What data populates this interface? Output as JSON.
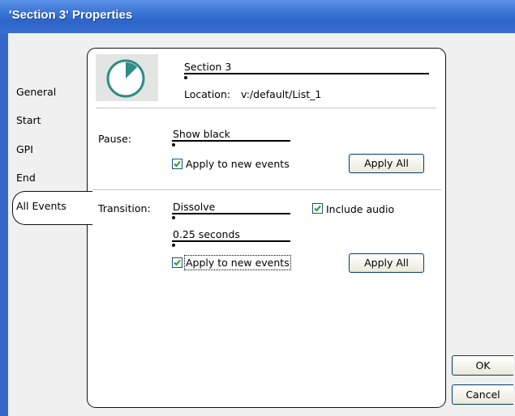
{
  "window": {
    "title": "'Section 3' Properties"
  },
  "tabs": [
    {
      "label": "General"
    },
    {
      "label": "Start"
    },
    {
      "label": "GPI"
    },
    {
      "label": "End"
    },
    {
      "label": "All Events",
      "selected": true
    }
  ],
  "header": {
    "section_name": "Section 3",
    "location_label": "Location:",
    "location_value": "v:/default/List_1",
    "icon": "clock-pie-icon"
  },
  "pause": {
    "label": "Pause:",
    "value": "Show black",
    "apply_new_label": "Apply to new events",
    "apply_new_checked": true,
    "apply_all_label": "Apply All"
  },
  "transition": {
    "label": "Transition:",
    "type_value": "Dissolve",
    "duration_value": "0.25 seconds",
    "include_audio_label": "Include audio",
    "include_audio_checked": true,
    "apply_new_label": "Apply to new events",
    "apply_new_checked": true,
    "apply_all_label": "Apply All"
  },
  "buttons": {
    "ok_label": "OK",
    "cancel_label": "Cancel"
  },
  "colors": {
    "titlebar": "#2d64c8",
    "check": "#21a121",
    "icon": "#2f8c86"
  }
}
